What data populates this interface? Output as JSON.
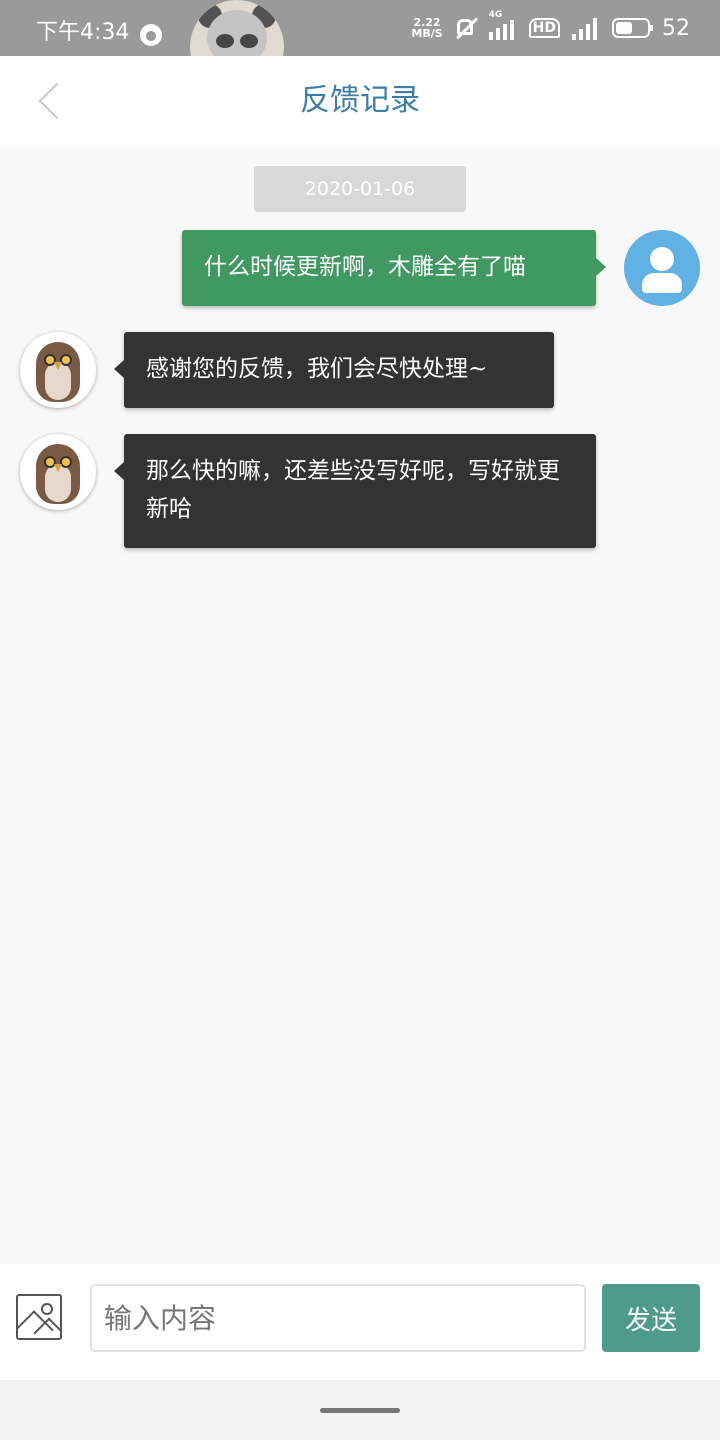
{
  "status_bar": {
    "time": "下午4:34",
    "net_speed_value": "2.22",
    "net_speed_unit": "MB/S",
    "network_type": "4G",
    "hd_label": "HD",
    "battery": "52"
  },
  "header": {
    "title": "反馈记录"
  },
  "chat": {
    "date": "2020-01-06",
    "messages": [
      {
        "sender": "user",
        "text": "什么时候更新啊，木雕全有了喵"
      },
      {
        "sender": "support",
        "text": "感谢您的反馈，我们会尽快处理~"
      },
      {
        "sender": "support",
        "text": "那么快的嘛，还差些没写好呢，写好就更新哈"
      }
    ]
  },
  "input_bar": {
    "placeholder": "输入内容",
    "value": "",
    "send_label": "发送"
  },
  "icons": {
    "back": "chevron-left-icon",
    "image": "image-icon",
    "user_avatar": "user-avatar-icon",
    "support_avatar": "owl-avatar-icon"
  },
  "colors": {
    "title": "#3b7eaa",
    "user_bubble": "#3f9960",
    "support_bubble": "#333333",
    "send_button": "#4e9b8c",
    "user_avatar": "#5fb2e3"
  }
}
